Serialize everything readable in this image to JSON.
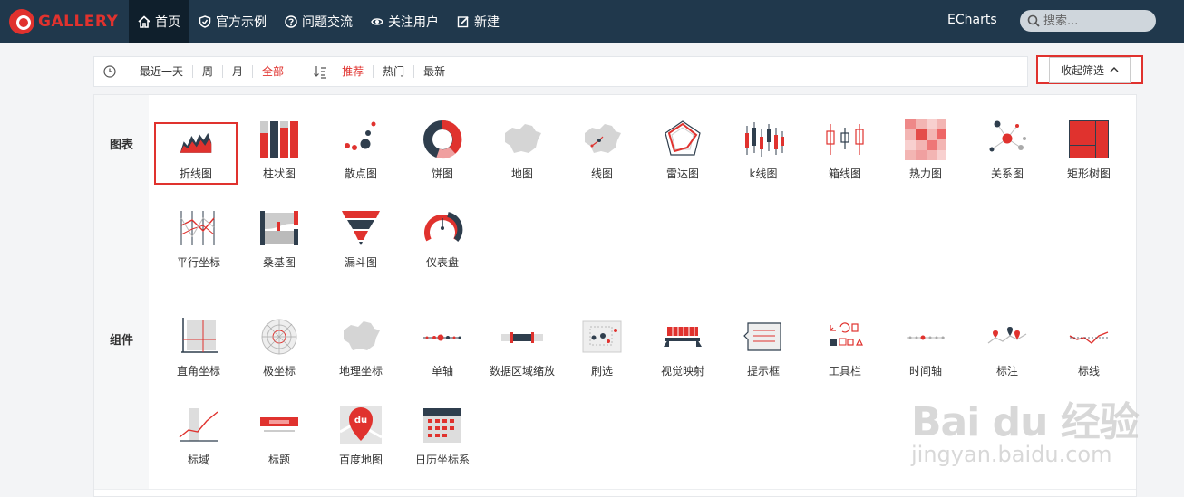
{
  "logo": {
    "text": "GALLERY"
  },
  "nav": [
    {
      "label": "首页",
      "icon": "home-icon",
      "active": true
    },
    {
      "label": "官方示例",
      "icon": "shield-icon"
    },
    {
      "label": "问题交流",
      "icon": "question-icon"
    },
    {
      "label": "关注用户",
      "icon": "eye-icon"
    },
    {
      "label": "新建",
      "icon": "edit-icon"
    }
  ],
  "echarts_link": "ECharts",
  "search": {
    "placeholder": "搜索..."
  },
  "filter": {
    "time": [
      "最近一天",
      "周",
      "月",
      "全部"
    ],
    "time_active": "全部",
    "sort": [
      "推荐",
      "热门",
      "最新"
    ],
    "sort_active": "推荐",
    "collapse_label": "收起筛选"
  },
  "sections": {
    "charts": {
      "title": "图表",
      "items": [
        "折线图",
        "柱状图",
        "散点图",
        "饼图",
        "地图",
        "线图",
        "雷达图",
        "k线图",
        "箱线图",
        "热力图",
        "关系图",
        "矩形树图",
        "平行坐标",
        "桑基图",
        "漏斗图",
        "仪表盘"
      ]
    },
    "components": {
      "title": "组件",
      "items": [
        "直角坐标",
        "极坐标",
        "地理坐标",
        "单轴",
        "数据区域缩放",
        "刷选",
        "视觉映射",
        "提示框",
        "工具栏",
        "时间轴",
        "标注",
        "标线",
        "标域",
        "标题",
        "百度地图",
        "日历坐标系"
      ]
    }
  },
  "watermark": {
    "main": "Bai du 经验",
    "sub": "jingyan.baidu.com"
  },
  "colors": {
    "accent": "#e0322e",
    "navy": "#20384c",
    "dark": "#2f3e4d"
  }
}
